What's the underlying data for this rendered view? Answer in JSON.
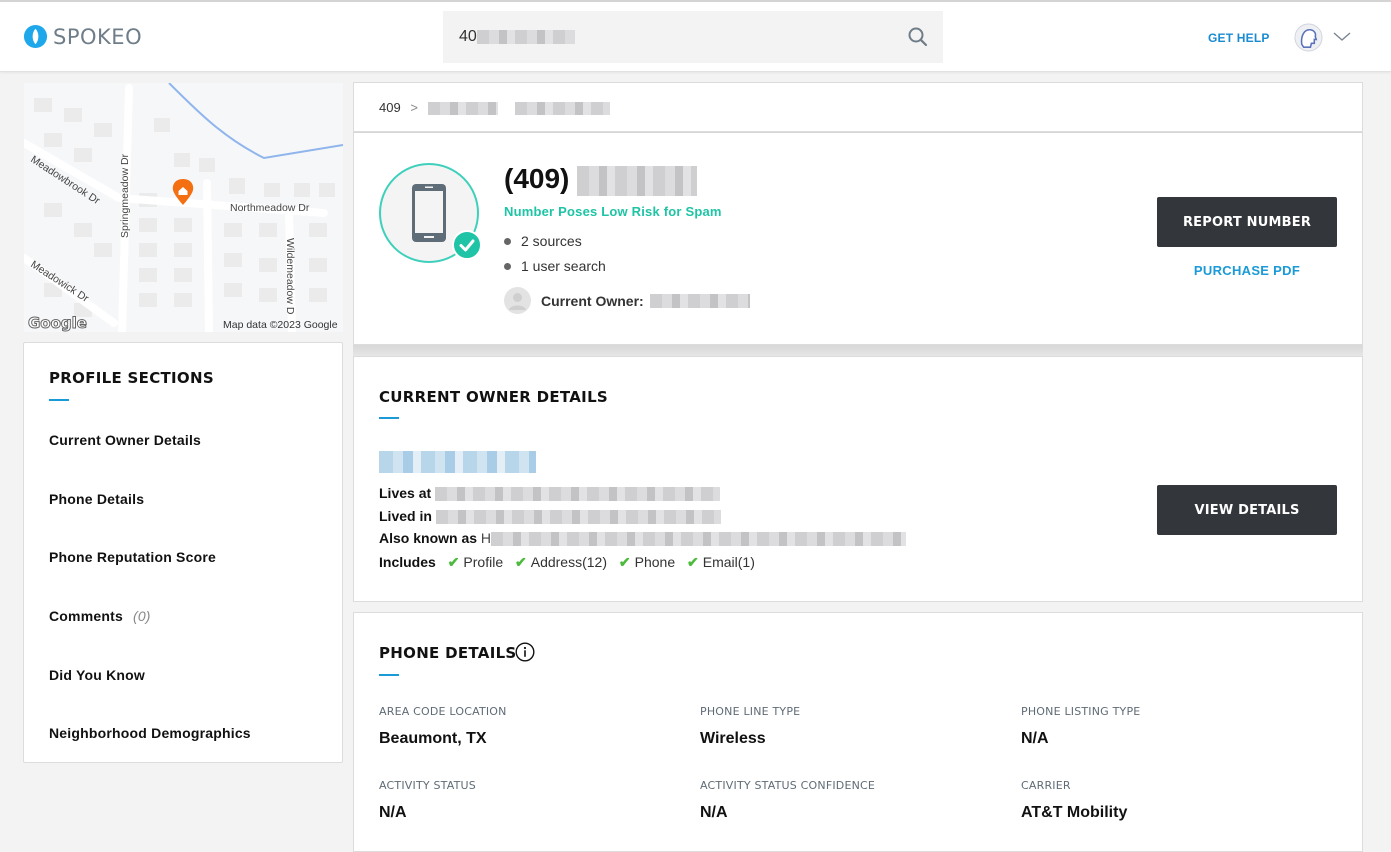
{
  "header": {
    "logo_text": "SPOKEO",
    "search_value_prefix": "40",
    "get_help": "GET HELP"
  },
  "map": {
    "streets": [
      "Meadowbrook Dr",
      "Springmeadow Dr",
      "Northmeadow Dr",
      "Meadowick Dr",
      "Wildemeadow D"
    ],
    "attribution": "Map data ©2023 Google",
    "google_logo": "Google"
  },
  "sidebar": {
    "title": "PROFILE SECTIONS",
    "items": [
      {
        "label": "Current Owner Details"
      },
      {
        "label": "Phone Details"
      },
      {
        "label": "Phone Reputation Score"
      },
      {
        "label": "Comments",
        "count": "(0)"
      },
      {
        "label": "Did You Know"
      },
      {
        "label": "Neighborhood Demographics"
      }
    ]
  },
  "breadcrumb": {
    "first": "409",
    "separator": ">"
  },
  "summary": {
    "phone_prefix": "(409)",
    "spam_status": "Number Poses Low Risk for Spam",
    "sources": "2 sources",
    "user_searches": "1 user search",
    "owner_label": "Current Owner:",
    "report_button": "REPORT NUMBER",
    "purchase_pdf": "PURCHASE PDF",
    "accent_color": "#1ec4a5"
  },
  "owner_details": {
    "title": "CURRENT OWNER DETAILS",
    "lives_at": "Lives at",
    "lived_in": "Lived in",
    "also_known_as": "Also known as",
    "aka_prefix": "H",
    "includes_label": "Includes",
    "includes": [
      "Profile",
      "Address(12)",
      "Phone",
      "Email(1)"
    ],
    "view_button": "VIEW DETAILS"
  },
  "phone_details": {
    "title": "PHONE DETAILS",
    "fields": [
      {
        "label": "AREA CODE LOCATION",
        "value": "Beaumont, TX"
      },
      {
        "label": "PHONE LINE TYPE",
        "value": "Wireless"
      },
      {
        "label": "PHONE LISTING TYPE",
        "value": "N/A"
      },
      {
        "label": "ACTIVITY STATUS",
        "value": "N/A"
      },
      {
        "label": "ACTIVITY STATUS CONFIDENCE",
        "value": "N/A"
      },
      {
        "label": "CARRIER",
        "value": "AT&T Mobility"
      }
    ]
  }
}
